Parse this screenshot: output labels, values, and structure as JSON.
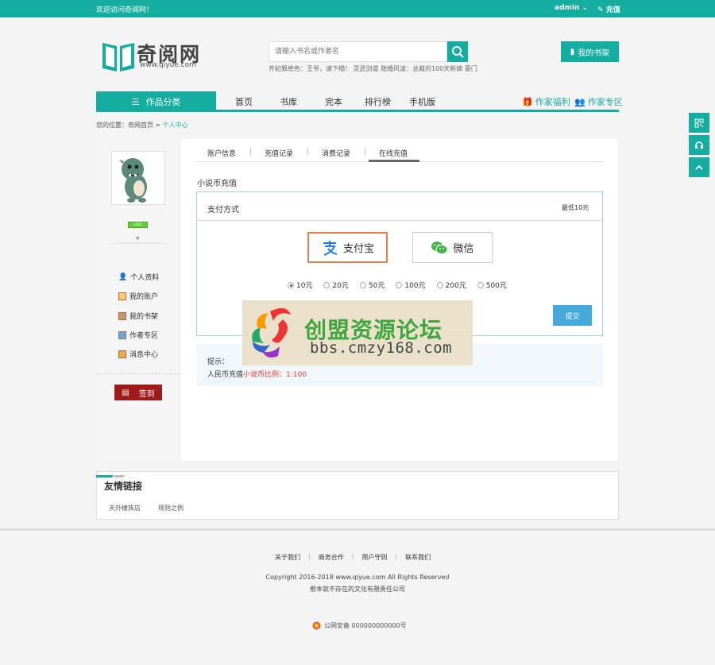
{
  "topbar": {
    "welcome": "欢迎访问奇闻网！",
    "user": "admin",
    "recharge": "充值"
  },
  "logo": {
    "title": "奇阅网",
    "url": "www.qiyue.com"
  },
  "search": {
    "placeholder": "请输入书名或作者名",
    "hot_words": "齐妃狠绝色：王爷，请下榻！ 灵武剑道 隐婚风波：总裁的100天新娘 豪门"
  },
  "header": {
    "shelf_label": "我的书架"
  },
  "nav": {
    "category": "作品分类",
    "items": [
      "首页",
      "书库",
      "完本",
      "排行榜",
      "手机版"
    ],
    "author_welfare": "作家福利",
    "author_zone": "作家专区"
  },
  "breadcrumb": {
    "prefix": "您的位置：",
    "home": "奇网首页",
    "sep": ">",
    "current": "个人中心"
  },
  "sidebar": {
    "badge": "LV.0",
    "items": [
      "个人资料",
      "我的账户",
      "我的书架",
      "作者专区",
      "消息中心"
    ],
    "sign_label": "签到"
  },
  "tabs": [
    "账户信息",
    "充值记录",
    "消费记录",
    "在线充值"
  ],
  "recharge": {
    "section_title": "小说币充值",
    "pay_method_label": "支付方式",
    "min_note": "最低10元",
    "methods": [
      "支付宝",
      "微信"
    ],
    "amounts": [
      "10元",
      "20元",
      "50元",
      "100元",
      "200元",
      "500元"
    ],
    "selected_amount_index": 0,
    "submit_label": "提交"
  },
  "tip": {
    "title": "提示：",
    "text_prefix": "人民币充值",
    "text_red": "小说币比例：1:100"
  },
  "watermark": {
    "cn": "创盟资源论坛",
    "en": "bbs.cmzy168.com"
  },
  "friend_links": {
    "title": "友情链接",
    "items": [
      "天外楼族店",
      "规则之例"
    ]
  },
  "footer": {
    "links": [
      "关于我们",
      "商务合作",
      "用户守则",
      "联系我们"
    ],
    "copyright": "Copyright 2016-2018 www.qiyue.com All Rights Reserved",
    "company": "根本就不存在的文化有限责任公司",
    "police": "公网安备 000000000000号"
  },
  "colors": {
    "primary": "#14ada0",
    "alipay": "#1678ff",
    "wechat": "#44b549",
    "sign": "#a01a1a",
    "submit": "#46a9d9"
  }
}
